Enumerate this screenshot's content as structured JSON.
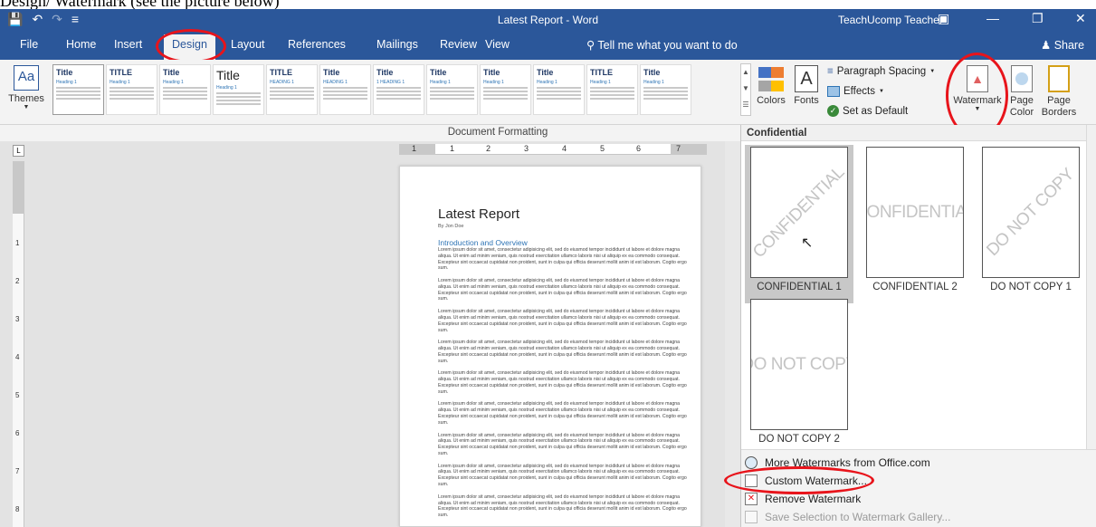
{
  "caption": "Design/ Watermark (see the picture below)",
  "titlebar": {
    "title": "Latest Report - Word",
    "user": "TeachUcomp Teacher",
    "qa_save": "💾",
    "qa_undo": "↶",
    "qa_redo": "↷",
    "qa_more": "≡"
  },
  "tabs": {
    "file": "File",
    "home": "Home",
    "insert": "Insert",
    "design": "Design",
    "layout": "Layout",
    "references": "References",
    "mailings": "Mailings",
    "review": "Review",
    "view": "View"
  },
  "tellme": "Tell me what you want to do",
  "share": "Share",
  "ribbon": {
    "themes": "Themes",
    "colors": "Colors",
    "fonts": "Fonts",
    "paragraph_spacing": "Paragraph Spacing",
    "effects": "Effects",
    "set_default": "Set as Default",
    "watermark": "Watermark",
    "page_color": "Page Color",
    "page_borders": "Page Borders",
    "style_sets": [
      {
        "title": "Title",
        "heading": "Heading 1"
      },
      {
        "title": "TITLE",
        "heading": "Heading 1"
      },
      {
        "title": "Title",
        "heading": "Heading 1"
      },
      {
        "title": "Title",
        "heading": "Heading 1"
      },
      {
        "title": "TITLE",
        "heading": "HEADING 1"
      },
      {
        "title": "Title",
        "heading": "HEADING 1"
      },
      {
        "title": "Title",
        "heading": "1 HEADING 1"
      },
      {
        "title": "Title",
        "heading": "Heading 1"
      },
      {
        "title": "Title",
        "heading": "Heading 1"
      },
      {
        "title": "Title",
        "heading": "Heading 1"
      },
      {
        "title": "TITLE",
        "heading": "Heading 1"
      },
      {
        "title": "Title",
        "heading": "Heading 1"
      }
    ]
  },
  "doc_formatting": "Document Formatting",
  "ruler": {
    "h": [
      "1",
      "1",
      "2",
      "3",
      "4",
      "5",
      "6",
      "7"
    ],
    "v": [
      "1",
      "2",
      "3",
      "4",
      "5",
      "6",
      "7",
      "8"
    ]
  },
  "document": {
    "title": "Latest Report",
    "byline": "By Jon Doe",
    "section": "Introduction and Overview",
    "paragraph": "Lorem ipsum dolor sit amet, consectetur adipisicing elit, sed do eiusmod tempor incididunt ut labore et dolore magna aliqua. Ut enim ad minim veniam, quis nostrud exercitation ullamco laboris nisi ut aliquip ex ea commodo consequat. Excepteur sint occaecat cupidatat non proident, sunt in culpa qui officia deserunt mollit anim id est laborum. Cogito ergo sum."
  },
  "watermark_panel": {
    "header": "Confidential",
    "items": [
      {
        "caption": "CONFIDENTIAL 1",
        "text": "CONFIDENTIAL",
        "style": "diagonal"
      },
      {
        "caption": "CONFIDENTIAL 2",
        "text": "CONFIDENTIAL",
        "style": "horizontal"
      },
      {
        "caption": "DO NOT COPY 1",
        "text": "DO NOT COPY",
        "style": "diagonal"
      },
      {
        "caption": "DO NOT COPY 2",
        "text": "DO NOT COPY",
        "style": "horizontal"
      }
    ],
    "menu": {
      "more": "More Watermarks from Office.com",
      "custom": "Custom Watermark...",
      "remove": "Remove Watermark",
      "save": "Save Selection to Watermark Gallery..."
    }
  },
  "colors": {
    "word_blue": "#2b579a",
    "annotation_red": "#e8141b",
    "heading_blue": "#2e74b5"
  }
}
